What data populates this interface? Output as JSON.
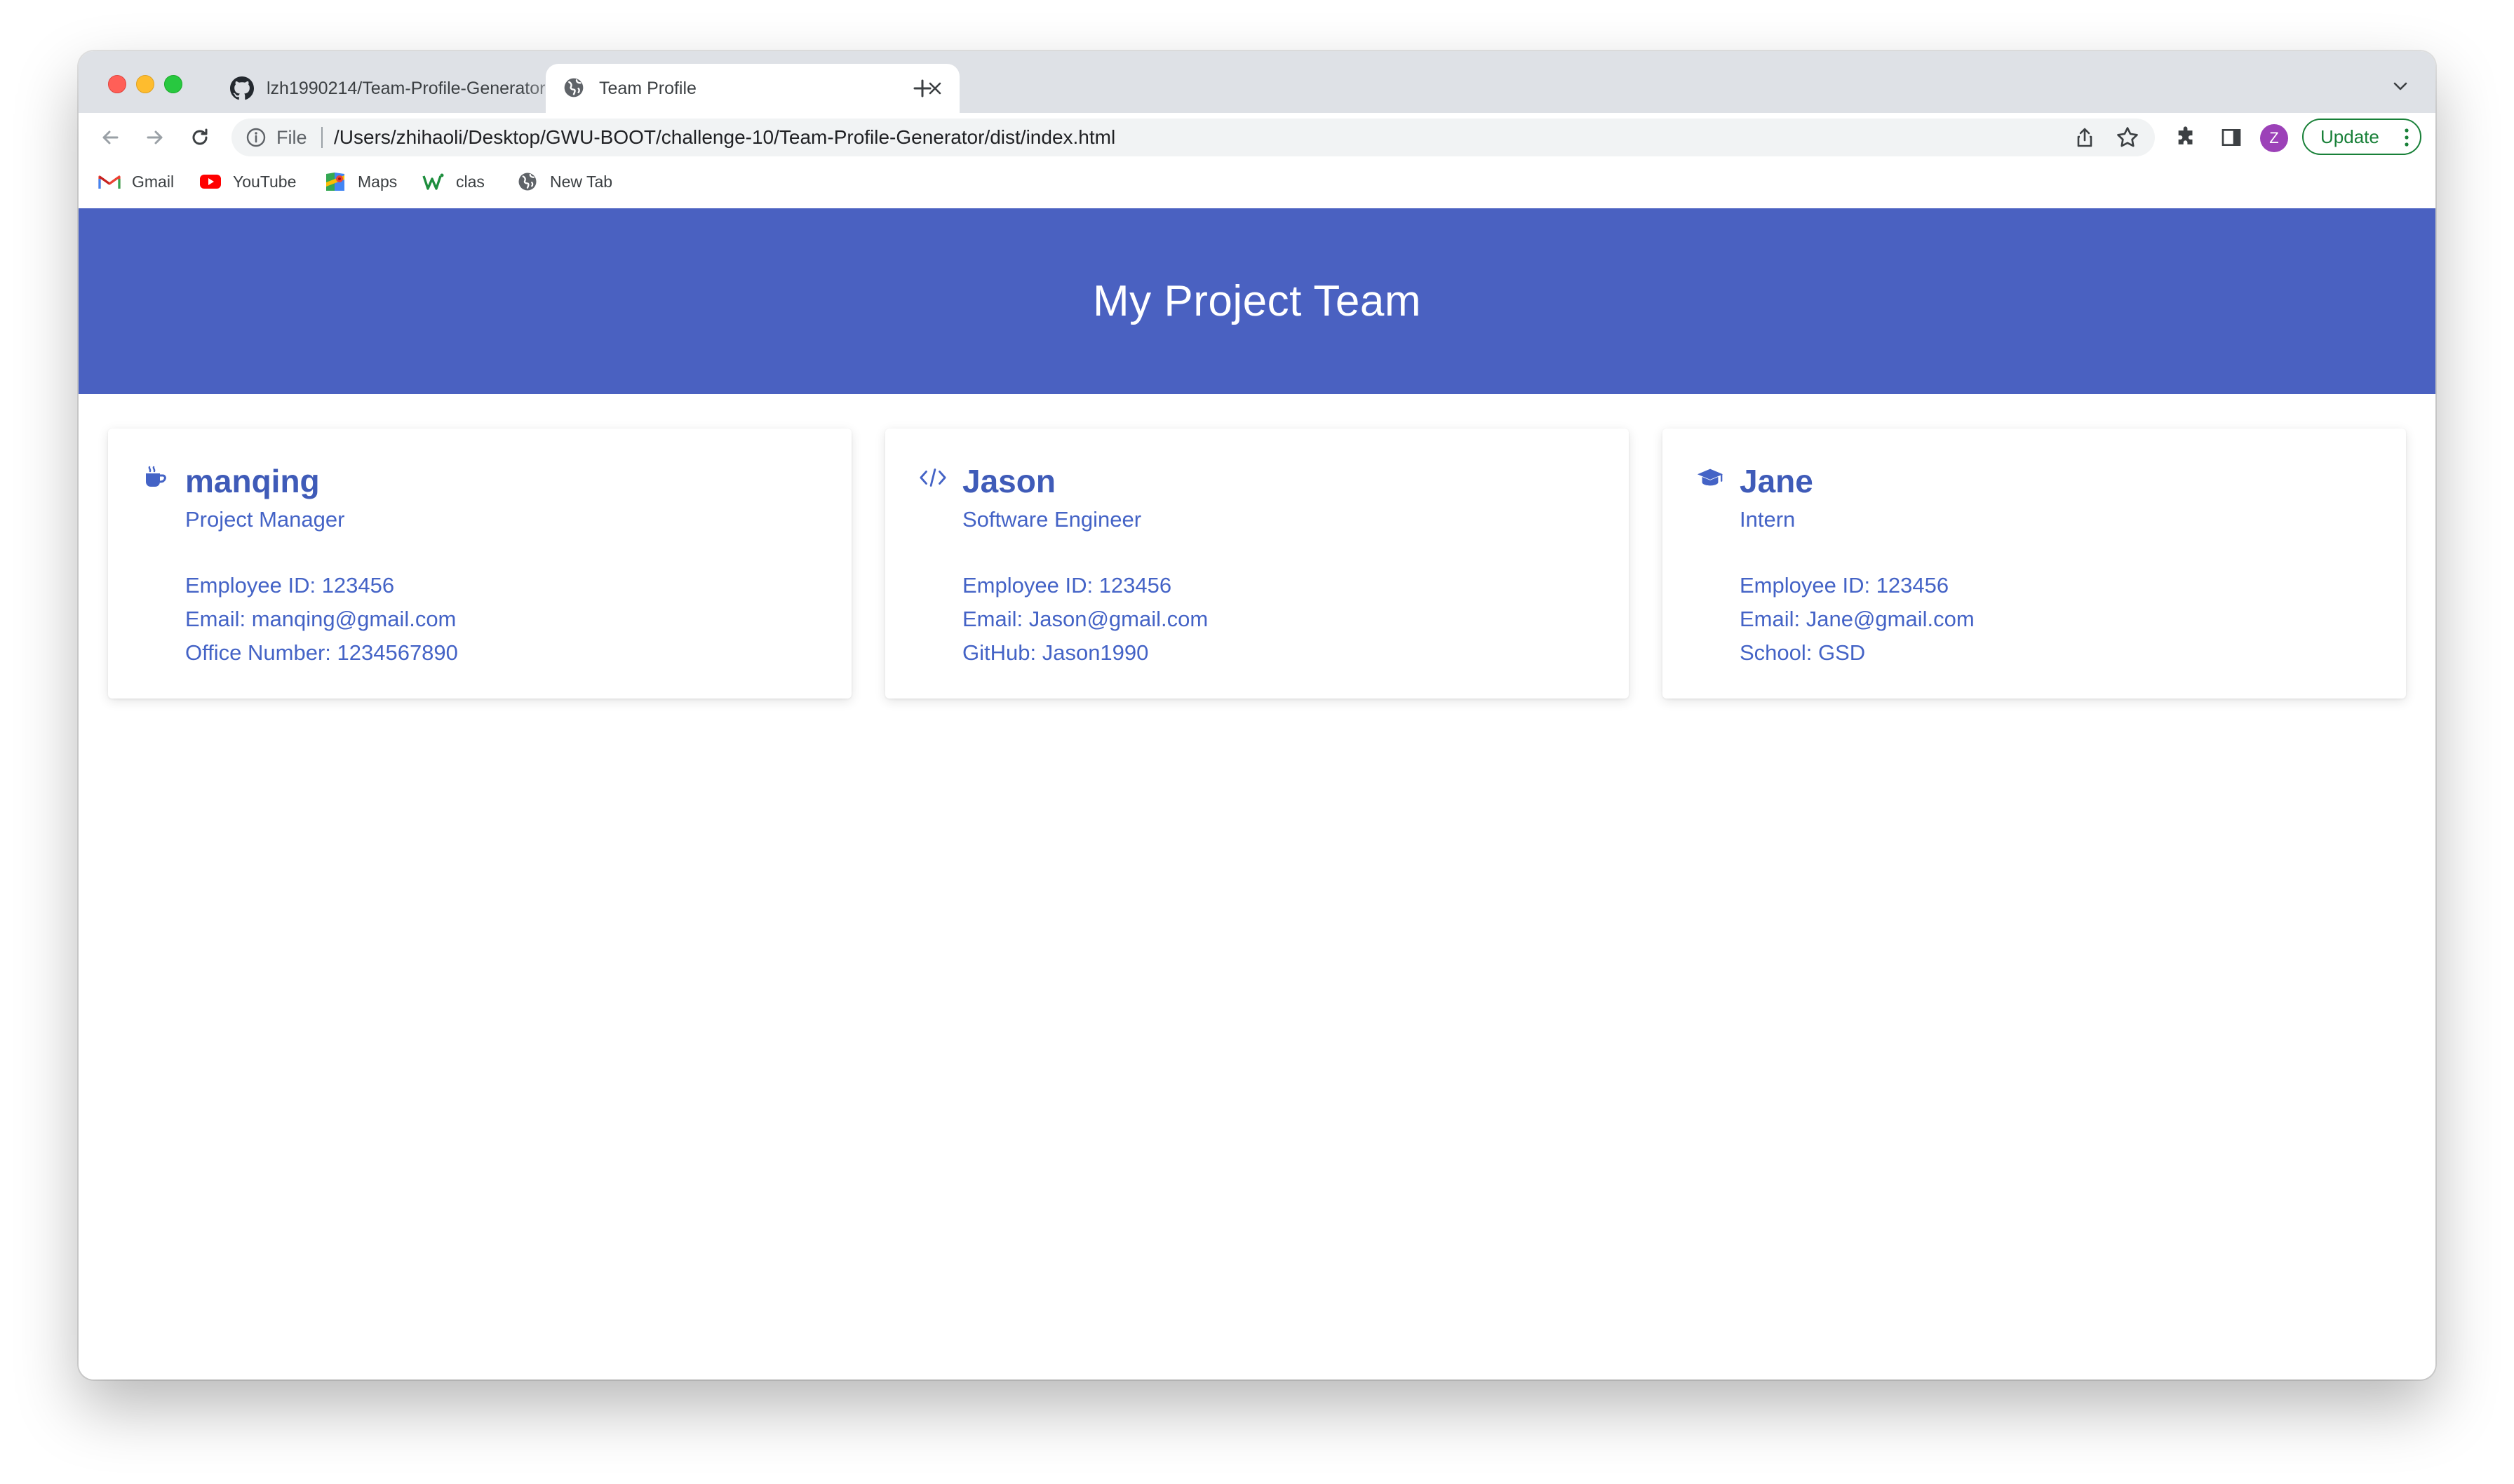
{
  "browser": {
    "tabs": [
      {
        "title": "lzh1990214/Team-Profile-Generator",
        "icon": "github-icon"
      },
      {
        "title": "Team Profile",
        "icon": "globe-icon"
      }
    ],
    "address_bar": {
      "scheme_label": "File",
      "url": "/Users/zhihaoli/Desktop/GWU-BOOT/challenge-10/Team-Profile-Generator/dist/index.html"
    },
    "profile_initial": "Z",
    "update_label": "Update",
    "bookmarks": [
      {
        "label": "Gmail",
        "icon": "gmail-icon"
      },
      {
        "label": "YouTube",
        "icon": "youtube-icon"
      },
      {
        "label": "Maps",
        "icon": "maps-icon"
      },
      {
        "label": "clas",
        "icon": "w-icon"
      },
      {
        "label": "New Tab",
        "icon": "globe-icon"
      }
    ]
  },
  "page": {
    "title": "My Project Team",
    "colors": {
      "header_bg": "#4a61c1",
      "accent_text": "#4463c6"
    },
    "cards": [
      {
        "icon": "coffee-mug-icon",
        "name": "manqing",
        "role": "Project Manager",
        "details": [
          "Employee ID: 123456",
          "Email: manqing@gmail.com",
          "Office Number: 1234567890"
        ]
      },
      {
        "icon": "code-icon",
        "name": "Jason",
        "role": "Software Engineer",
        "details": [
          "Employee ID: 123456",
          "Email: Jason@gmail.com",
          "GitHub: Jason1990"
        ]
      },
      {
        "icon": "graduation-cap-icon",
        "name": "Jane",
        "role": "Intern",
        "details": [
          "Employee ID: 123456",
          "Email: Jane@gmail.com",
          "School: GSD"
        ]
      }
    ]
  }
}
